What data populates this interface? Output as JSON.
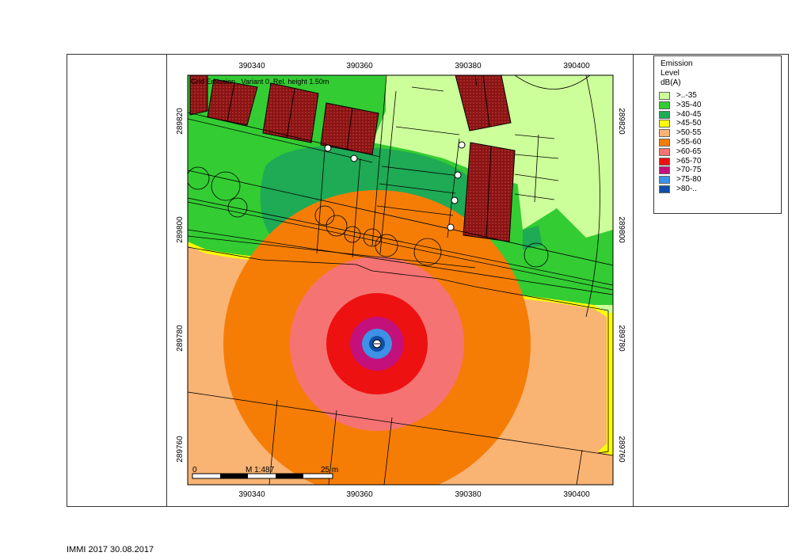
{
  "map": {
    "title": "Grid Emission , Variant 0, Rel. height 1.50m",
    "x_ticks": [
      "390340",
      "390360",
      "390380",
      "390400"
    ],
    "y_ticks": [
      "289820",
      "289800",
      "289780",
      "289760"
    ],
    "scale_bar": {
      "start": "0",
      "scale": "M 1:487",
      "end": "25 m"
    }
  },
  "legend": {
    "title_lines": [
      "Emission",
      "Level",
      "dB(A)"
    ],
    "items": [
      {
        "label": ">..-35",
        "color": "#ccff99"
      },
      {
        "label": ">35-40",
        "color": "#33cc33"
      },
      {
        "label": ">40-45",
        "color": "#1faa55"
      },
      {
        "label": ">45-50",
        "color": "#ffff00"
      },
      {
        "label": ">50-55",
        "color": "#f9b373"
      },
      {
        "label": ">55-60",
        "color": "#f57d06"
      },
      {
        "label": ">60-65",
        "color": "#f57373"
      },
      {
        "label": ">65-70",
        "color": "#ee1111"
      },
      {
        "label": ">70-75",
        "color": "#c4107a"
      },
      {
        "label": ">75-80",
        "color": "#3d91e6"
      },
      {
        "label": ">80-..",
        "color": "#0f4fa8"
      }
    ]
  },
  "footer": {
    "text": "IMMI 2017 30.08.2017"
  }
}
